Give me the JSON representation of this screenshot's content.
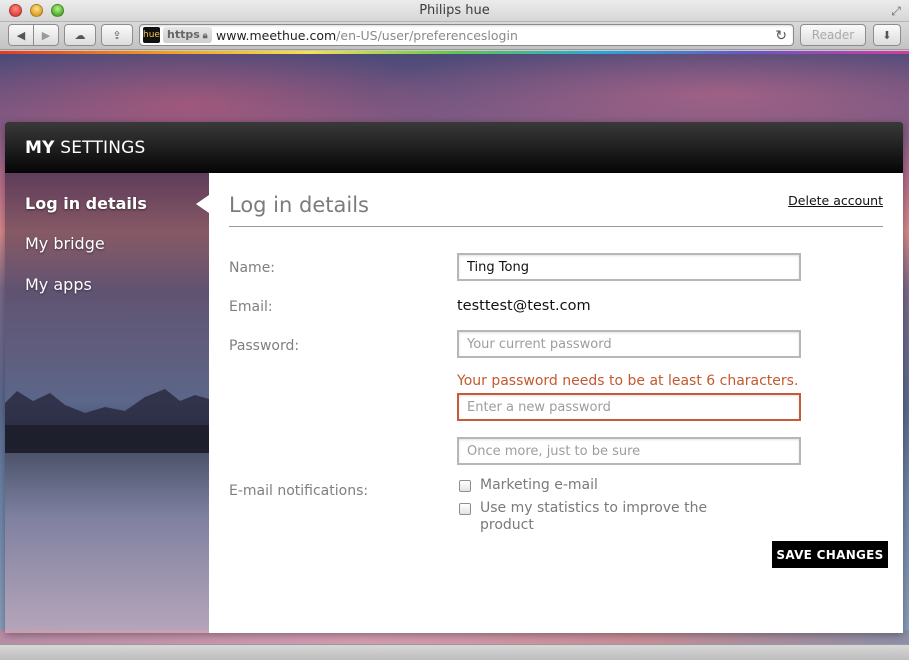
{
  "window": {
    "title": "Philips hue"
  },
  "toolbar": {
    "back_icon": "◀",
    "forward_icon": "▶",
    "cloud_icon": "☁",
    "share_icon": "⇪",
    "reader_label": "Reader",
    "downloads_icon": "⬇"
  },
  "urlbar": {
    "favicon_text": "hue",
    "scheme": "https",
    "domain": "www.meethue.com",
    "path": "/en-US/user/preferenceslogin"
  },
  "panel": {
    "title_bold": "MY",
    "title_light": " SETTINGS"
  },
  "sidebar": {
    "items": [
      {
        "label": "Log in details",
        "active": true
      },
      {
        "label": "My bridge",
        "active": false
      },
      {
        "label": "My apps",
        "active": false
      }
    ]
  },
  "content": {
    "title": "Log in details",
    "delete_link": "Delete account",
    "labels": {
      "name": "Name:",
      "email": "Email:",
      "password": "Password:",
      "notifications": "E-mail notifications:"
    },
    "name_value": "Ting Tong",
    "email_value": "testtest@test.com",
    "current_password_placeholder": "Your current password",
    "password_error": "Your password needs to be at least 6 characters.",
    "new_password_placeholder": "Enter a new password",
    "confirm_password_placeholder": "Once more, just to be sure",
    "checkboxes": [
      {
        "label": "Marketing e-mail",
        "checked": false
      },
      {
        "label": "Use my statistics to improve the product",
        "checked": false
      }
    ],
    "save_label": "SAVE CHANGES"
  },
  "colors": {
    "error": "#c3592e",
    "header_bg": "#050505",
    "label_gray": "#7f7f7f"
  }
}
